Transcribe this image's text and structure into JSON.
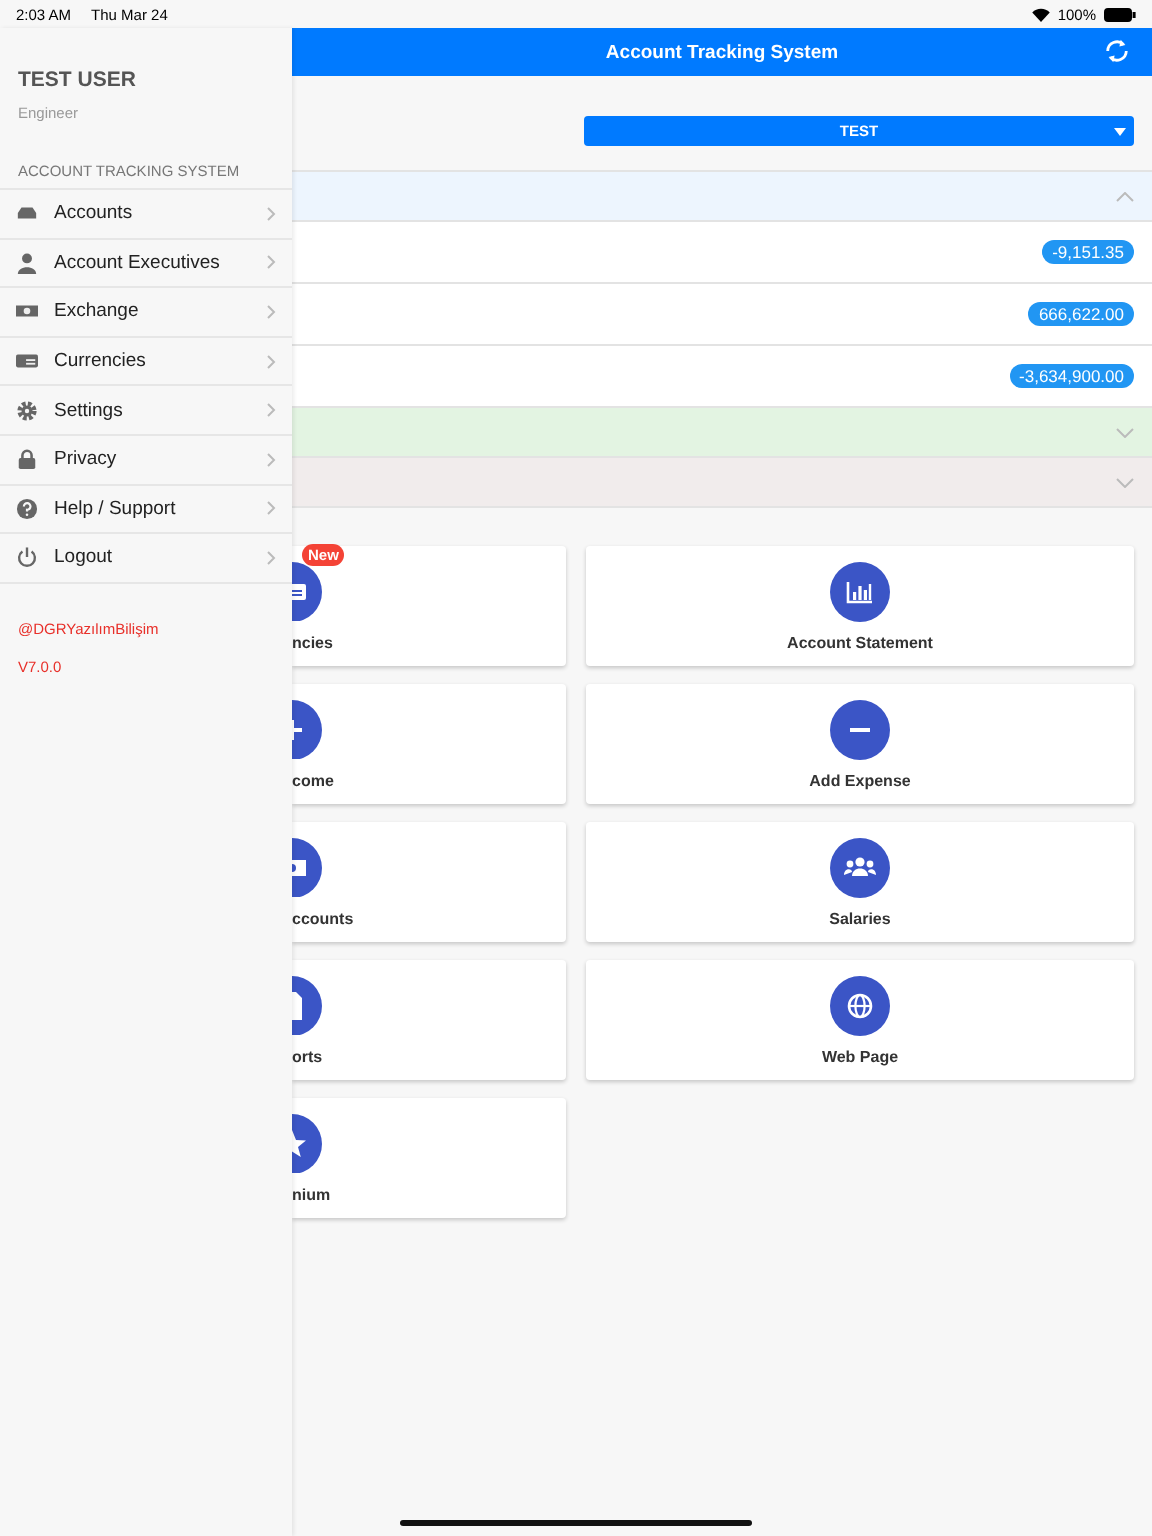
{
  "status_bar": {
    "time": "2:03 AM",
    "date": "Thu Mar 24",
    "battery": "100%"
  },
  "drawer": {
    "user": "TEST USER",
    "role": "Engineer",
    "section": "ACCOUNT TRACKING SYSTEM",
    "items": [
      {
        "label": "Accounts"
      },
      {
        "label": "Account Executives"
      },
      {
        "label": "Exchange"
      },
      {
        "label": "Currencies"
      },
      {
        "label": "Settings"
      },
      {
        "label": "Privacy"
      },
      {
        "label": "Help / Support"
      },
      {
        "label": "Logout"
      }
    ],
    "company": "@DGRYazılımBilişim",
    "version": "V7.0.0"
  },
  "header": {
    "title": "Account Tracking System"
  },
  "company_select": {
    "value": "TEST"
  },
  "summary": [
    {
      "color": "#edf5fe",
      "expanded": true,
      "amounts": [
        "-9,151.35",
        "666,622.00",
        "-3,634,900.00"
      ]
    },
    {
      "color": "#e3f4e2",
      "expanded": false
    },
    {
      "color": "#f1ecec",
      "expanded": false
    }
  ],
  "tiles": [
    {
      "label": "ncies",
      "badge": "New"
    },
    {
      "label": "Account Statement"
    },
    {
      "label": "come"
    },
    {
      "label": "Add Expense"
    },
    {
      "label": "ccounts"
    },
    {
      "label": "Salaries"
    },
    {
      "label": "orts"
    },
    {
      "label": "Web Page"
    },
    {
      "label": "nium"
    }
  ]
}
